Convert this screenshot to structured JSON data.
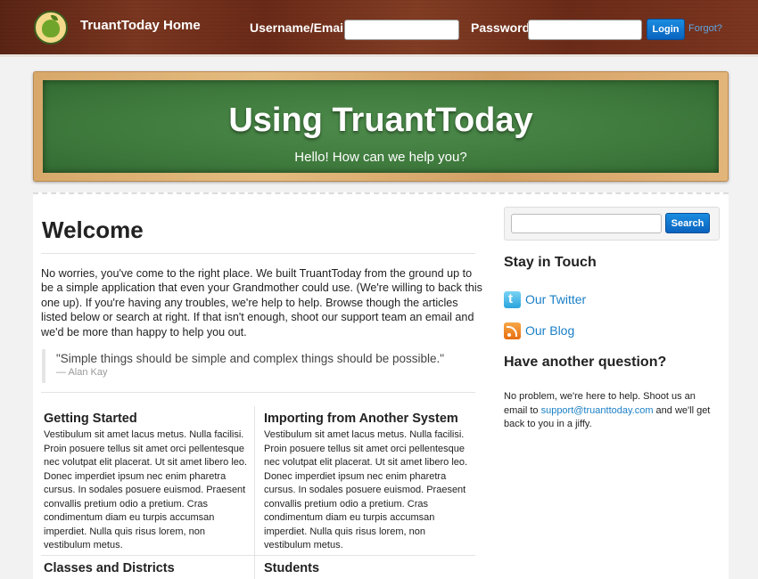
{
  "header": {
    "brand": "TruantToday Home",
    "username_label": "Username/Email:",
    "username_value": "",
    "password_label": "Password:",
    "password_value": "",
    "login_label": "Login",
    "forgot_label": "Forgot?",
    "colors": {
      "accent": "#0a63bf",
      "link": "#5fa6e3"
    }
  },
  "hero": {
    "title": "Using TruantToday",
    "subtitle": "Hello! How can we help you?"
  },
  "main": {
    "heading": "Welcome",
    "intro": "No worries, you've come to the right place. We built TruantToday from the ground up to be a simple application that even your Grandmother could use. (We're willing to back this one up). If you're having any troubles, we're help to help. Browse though the articles listed below or search at right. If that isn't enough, shoot our support team an email and we'd be more than happy to help you out.",
    "quote": "\"Simple things should be simple and complex things should be possible.\"",
    "quote_author": "— Alan Kay",
    "cards": [
      {
        "title": "Getting Started",
        "body": "Vestibulum sit amet lacus metus. Nulla facilisi. Proin posuere tellus sit amet orci pellentesque nec volutpat elit placerat. Ut sit amet libero leo. Donec imperdiet ipsum nec enim pharetra cursus. In sodales posuere euismod. Praesent convallis pretium odio a pretium. Cras condimentum diam eu turpis accumsan imperdiet. Nulla quis risus lorem, non vestibulum metus."
      },
      {
        "title": "Importing from Another System",
        "body": "Vestibulum sit amet lacus metus. Nulla facilisi. Proin posuere tellus sit amet orci pellentesque nec volutpat elit placerat. Ut sit amet libero leo. Donec imperdiet ipsum nec enim pharetra cursus. In sodales posuere euismod. Praesent convallis pretium odio a pretium. Cras condimentum diam eu turpis accumsan imperdiet. Nulla quis risus lorem, non vestibulum metus."
      },
      {
        "title": "Classes and Districts"
      },
      {
        "title": "Students"
      }
    ]
  },
  "sidebar": {
    "search_placeholder": "",
    "search_label": "Search",
    "stay_heading": "Stay in Touch",
    "twitter_label": "Our Twitter",
    "blog_label": "Our Blog",
    "question_heading": "Have another question?",
    "help_before": "No problem, we're here to help. Shoot us an email to ",
    "help_email": "support@truanttoday.com",
    "help_after": " and we'll get back to you in a jiffy.",
    "icons": [
      "twitter-icon",
      "rss-icon",
      "apple-logo-icon"
    ]
  }
}
